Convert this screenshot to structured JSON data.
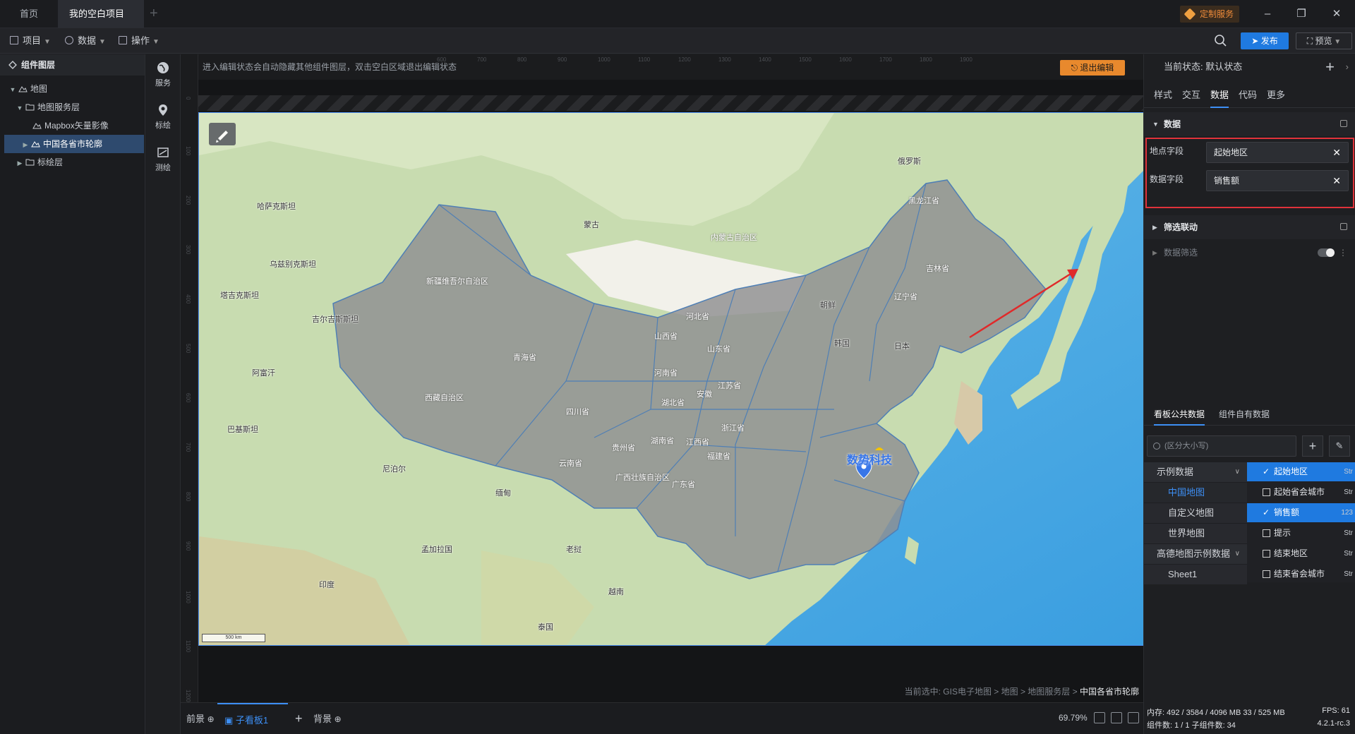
{
  "tabs": {
    "home": "首页",
    "project": "我的空白项目",
    "service": "定制服务"
  },
  "toolbar": {
    "menus": [
      "项目",
      "数据",
      "操作"
    ],
    "publish": "发布",
    "preview": "预览"
  },
  "layers": {
    "title": "组件图层",
    "items": [
      "地图",
      "地图服务层",
      "Mapbox矢量影像",
      "中国各省市轮廓",
      "标绘层"
    ]
  },
  "sidetools": [
    "服务",
    "标绘",
    "测绘"
  ],
  "canvas": {
    "hint": "进入编辑状态会自动隐藏其他组件图层，双击空白区域退出编辑状态",
    "exit_edit": "退出编辑",
    "breadcrumb_prefix": "当前选中: GIS电子地图 > 地图 > 地图服务层 > ",
    "breadcrumb_current": "中国各省市轮廓",
    "marker_label": "数势科技",
    "scale": "500 km",
    "ruler_top": [
      "600",
      "700",
      "800",
      "900",
      "1000",
      "1100",
      "1200",
      "1300",
      "1400",
      "1500",
      "1600",
      "1700",
      "1800",
      "1900"
    ],
    "ruler_left": [
      "0",
      "100",
      "200",
      "300",
      "400",
      "500",
      "600",
      "700",
      "800",
      "900",
      "1000",
      "1100",
      "1200"
    ]
  },
  "map": {
    "provinces": [
      {
        "name": "黑龙江省"
      },
      {
        "name": "内蒙古自治区"
      },
      {
        "name": "吉林省"
      },
      {
        "name": "辽宁省"
      },
      {
        "name": "新疆维吾尔自治区"
      },
      {
        "name": "河北省"
      },
      {
        "name": "山西省"
      },
      {
        "name": "山东省"
      },
      {
        "name": "青海省"
      },
      {
        "name": "河南省"
      },
      {
        "name": "江苏省"
      },
      {
        "name": "西藏自治区"
      },
      {
        "name": "四川省"
      },
      {
        "name": "湖北省"
      },
      {
        "name": "安徽"
      },
      {
        "name": "浙江省"
      },
      {
        "name": "湖南省"
      },
      {
        "name": "江西省"
      },
      {
        "name": "贵州省"
      },
      {
        "name": "福建省"
      },
      {
        "name": "云南省"
      },
      {
        "name": "广西壮族自治区"
      },
      {
        "name": "广东省"
      }
    ],
    "places": [
      "哈萨克斯坦",
      "乌兹别克斯坦",
      "吉尔吉斯斯坦",
      "塔吉克斯坦",
      "阿富汗",
      "巴基斯坦",
      "印度",
      "尼泊尔",
      "孟加拉国",
      "缅甸",
      "老挝",
      "越南",
      "泰国",
      "蒙古",
      "日本",
      "朝鲜",
      "韩国",
      "俄罗斯"
    ]
  },
  "status": {
    "tab_front": "前景",
    "tab_board": "子看板1",
    "tab_back": "背景",
    "zoom": "69.79%"
  },
  "right": {
    "current_state": "当前状态: 默认状态",
    "tabs": [
      "样式",
      "交互",
      "数据",
      "代码",
      "更多"
    ],
    "section_data": "数据",
    "field1_label": "地点字段",
    "field1_value": "起始地区",
    "field2_label": "数据字段",
    "field2_value": "销售额",
    "section_linkage": "筛选联动",
    "data_filter": "数据筛选",
    "data_tabs": [
      "看板公共数据",
      "组件自有数据"
    ],
    "search_placeholder": "(区分大小写)",
    "datasets": [
      {
        "label": "示例数据",
        "group": true
      },
      {
        "label": "中国地图",
        "active": true
      },
      {
        "label": "自定义地图"
      },
      {
        "label": "世界地图"
      },
      {
        "label": "高德地图示例数据",
        "group": true
      },
      {
        "label": "Sheet1"
      }
    ],
    "fields": [
      {
        "label": "起始地区",
        "type": "Str",
        "checked": true
      },
      {
        "label": "起始省会城市",
        "type": "Str",
        "checked": false
      },
      {
        "label": "销售额",
        "type": "123",
        "checked": true
      },
      {
        "label": "提示",
        "type": "Str",
        "checked": false
      },
      {
        "label": "结束地区",
        "type": "Str",
        "checked": false
      },
      {
        "label": "结束省会城市",
        "type": "Str",
        "checked": false
      }
    ],
    "perf": {
      "memory": "内存: 492 / 3584 / 4096 MB  33 / 525 MB",
      "fps": "FPS: 61",
      "components": "组件数: 1 / 1  子组件数: 34",
      "version": "4.2.1-rc.3"
    }
  }
}
